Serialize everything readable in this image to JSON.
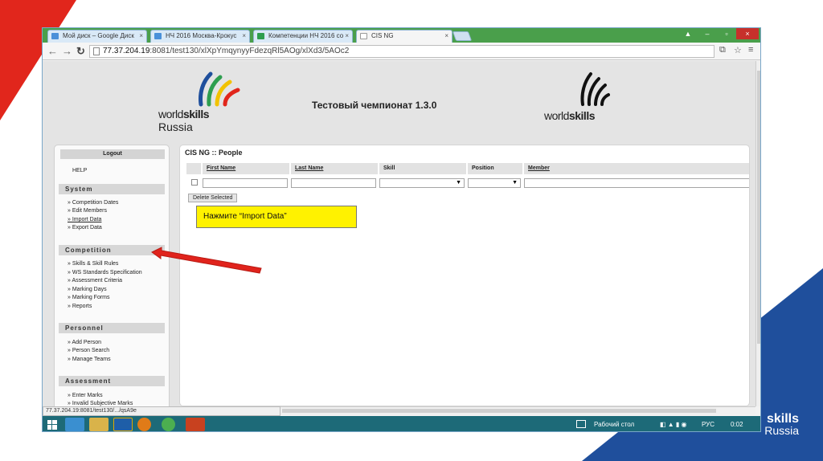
{
  "browser": {
    "tabs": [
      {
        "label": "Мой диск – Google Диск",
        "active": false,
        "icon_color": "#4a90d9"
      },
      {
        "label": "НЧ 2016 Москва-Крокус",
        "active": false,
        "icon_color": "#4a90d9"
      },
      {
        "label": "Компетенции НЧ 2016 со",
        "active": false,
        "icon_color": "#2e9e4f"
      },
      {
        "label": "CIS NG",
        "active": true,
        "icon_color": "#ffffff"
      }
    ],
    "close_glyph": "×",
    "window_controls": [
      "–",
      "▫",
      "×"
    ],
    "url_host": "77.37.204.19",
    "url_rest": ":8081/test130/xlXpYmqynyyFdezqRl5AOg/xlXd3/5AOc2",
    "status_url": "77.37.204.19:8081/test130/.../qsA9e"
  },
  "header": {
    "logo_left_word1": "world",
    "logo_left_word2": "skills",
    "logo_left_sub": "Russia",
    "title": "Тестовый чемпионат 1.3.0",
    "logo_right_word1": "world",
    "logo_right_word2": "skills"
  },
  "sidebar": {
    "logout": "Logout",
    "help": "HELP",
    "sections": [
      {
        "title": "System",
        "items": [
          "» Competition Dates",
          "» Edit Members",
          "» Import Data",
          "» Export Data"
        ]
      },
      {
        "title": "Competition",
        "items": [
          "» Skills & Skill Rules",
          "» WS Standards Specification",
          "» Assessment Criteria",
          "» Marking Days",
          "» Marking Forms",
          "» Reports"
        ]
      },
      {
        "title": "Personnel",
        "items": [
          "» Add Person",
          "» Person Search",
          "» Manage Teams"
        ]
      },
      {
        "title": "Assessment",
        "items": [
          "» Enter Marks",
          "» Invalid Subjective Marks"
        ]
      }
    ]
  },
  "content": {
    "title": "CIS NG :: People",
    "columns": [
      "First Name",
      "Last Name",
      "Skill",
      "Position",
      "Member"
    ],
    "delete_button": "Delete Selected",
    "callout": "Нажмите “Import Data”"
  },
  "taskbar": {
    "desktop_label": "Рабочий стол",
    "lang": "РУС",
    "time": "0:02"
  },
  "colors": {
    "callout_bg": "#fff200",
    "arrow": "#e0231c",
    "slide_red": "#e1261c",
    "slide_blue": "#1f4f9c",
    "taskbar": "#1d6a78"
  },
  "slide_logo": {
    "word": "skills",
    "sub": "Russia"
  }
}
